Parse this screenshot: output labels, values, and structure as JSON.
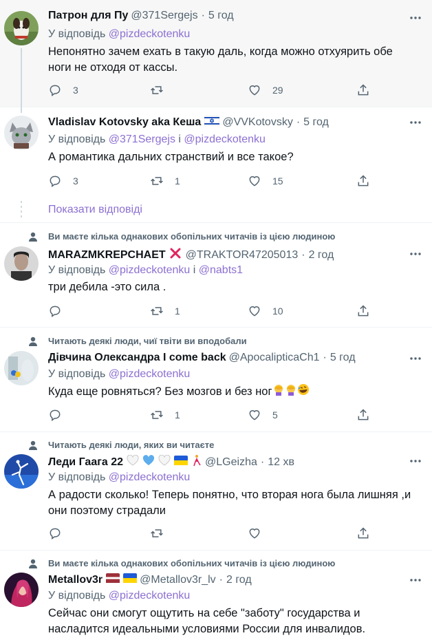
{
  "tweets": [
    {
      "name": "Патрон для Пу",
      "handle": "@371Sergejs",
      "time": "5 год",
      "reply_prefix": "У відповідь",
      "reply_to": [
        "@pizdeckotenku"
      ],
      "text": "Непонятно зачем ехать в такую даль, когда можно отхуярить обе ноги не отходя от кассы.",
      "replies": "3",
      "retweets": "",
      "likes": "29"
    },
    {
      "name": "Vladislav Kotovsky aka Кеша",
      "badge_flag": "israel-flag",
      "handle": "@VVKotovsky",
      "time": "5 год",
      "reply_prefix": "У відповідь",
      "reply_to": [
        "@371Sergejs",
        "@pizdeckotenku"
      ],
      "reply_join": "і",
      "text": "А романтика дальних странствий и все такое?",
      "replies": "3",
      "retweets": "1",
      "likes": "15"
    },
    {
      "social": "Ви маєте кілька однакових обопільних читачів із цією людиною",
      "name": "MARAZMKREPCHAET",
      "badge_flag": "red-x-icon",
      "handle": "@TRAKTOR47205013",
      "time": "2 год",
      "reply_prefix": "У відповідь",
      "reply_to": [
        "@pizdeckotenku",
        "@nabts1"
      ],
      "reply_join": "і",
      "text": "три дебила -это сила .",
      "replies": "",
      "retweets": "1",
      "likes": "10"
    },
    {
      "social": "Читають деякі люди, чиї твіти ви вподобали",
      "name": "Дівчина Олександра I come back",
      "handle": "@ApocalipticaCh1",
      "time": "5 год",
      "reply_prefix": "У відповідь",
      "reply_to": [
        "@pizdeckotenku"
      ],
      "text": "Куда еще ровняться? Без мозгов и без ног",
      "emojis": [
        "woman-facepalming",
        "woman-facepalming",
        "rolling-laughing"
      ],
      "replies": "",
      "retweets": "1",
      "likes": "5"
    },
    {
      "social": "Читають деякі люди, яких ви читаєте",
      "name": "Леди Гаага 22",
      "name_emojis": [
        "white-heart",
        "blue-heart",
        "white-heart",
        "ukraine-flag",
        "dancer"
      ],
      "handle": "@LGeizha",
      "time": "12 хв",
      "reply_prefix": "У відповідь",
      "reply_to": [
        "@pizdeckotenku"
      ],
      "text": "А радости сколько! Теперь понятно, что вторая нога была лишняя ,и они поэтому страдали",
      "replies": "",
      "retweets": "",
      "likes": ""
    },
    {
      "social": "Ви маєте кілька однакових обопільних читачів із цією людиною",
      "name": "Metallov3r",
      "name_emojis": [
        "latvia-flag",
        "ukraine-flag"
      ],
      "handle": "@Metallov3r_lv",
      "time": "2 год",
      "reply_prefix": "У відповідь",
      "reply_to": [
        "@pizdeckotenku"
      ],
      "text": "Сейчас они смогут ощутить на себе \"заботу\" государства и насладится идеальными условиями России для инвалидов."
    }
  ],
  "show_replies": "Показати відповіді",
  "dot": "·",
  "colors": {
    "link": "#8c6fd1",
    "secondary": "#536471",
    "highlight_bg": "#f7f7f7"
  }
}
